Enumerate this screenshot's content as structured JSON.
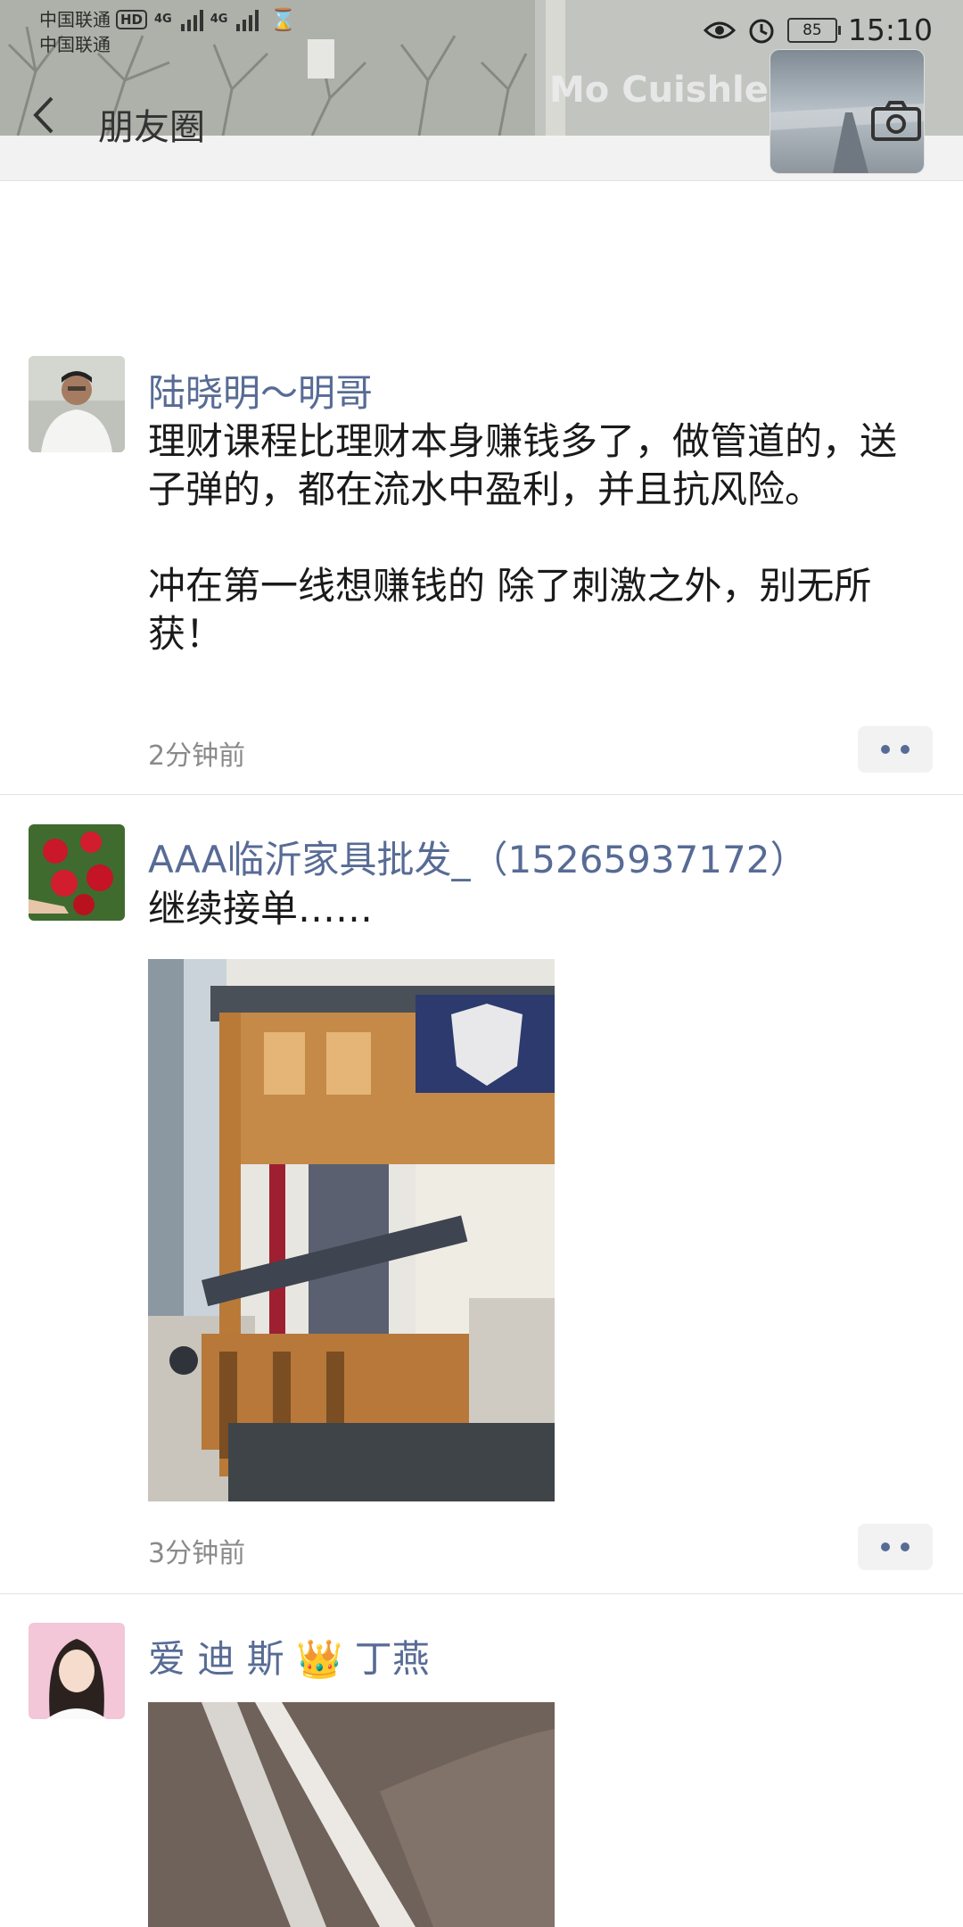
{
  "status_bar": {
    "carrier_1": "中国联通",
    "carrier_2": "中国联通",
    "hd_badge": "HD",
    "network_1": "4G",
    "network_2": "4G",
    "battery": "85",
    "time": "15:10"
  },
  "nav": {
    "title": "朋友圈",
    "back_icon": "chevron-left-icon",
    "camera_icon": "camera-icon"
  },
  "profile": {
    "name": "Mo Cuishle"
  },
  "posts": [
    {
      "name": "陆晓明～明哥",
      "text": "理财课程比理财本身赚钱多了，做管道的，送子弹的，都在流水中盈利，并且抗风险。\n\n冲在第一线想赚钱的 除了刺激之外，别无所获！",
      "time": "2分钟前"
    },
    {
      "name": "AAA临沂家具批发_（15265937172）",
      "text": "继续接单……",
      "time": "3分钟前"
    },
    {
      "name": "爱 迪 斯 👑 丁燕",
      "text": "",
      "time": ""
    }
  ],
  "colors": {
    "link_name": "#576b95",
    "nav_bg": "#f2f2f2",
    "divider": "#e3e3e3"
  }
}
